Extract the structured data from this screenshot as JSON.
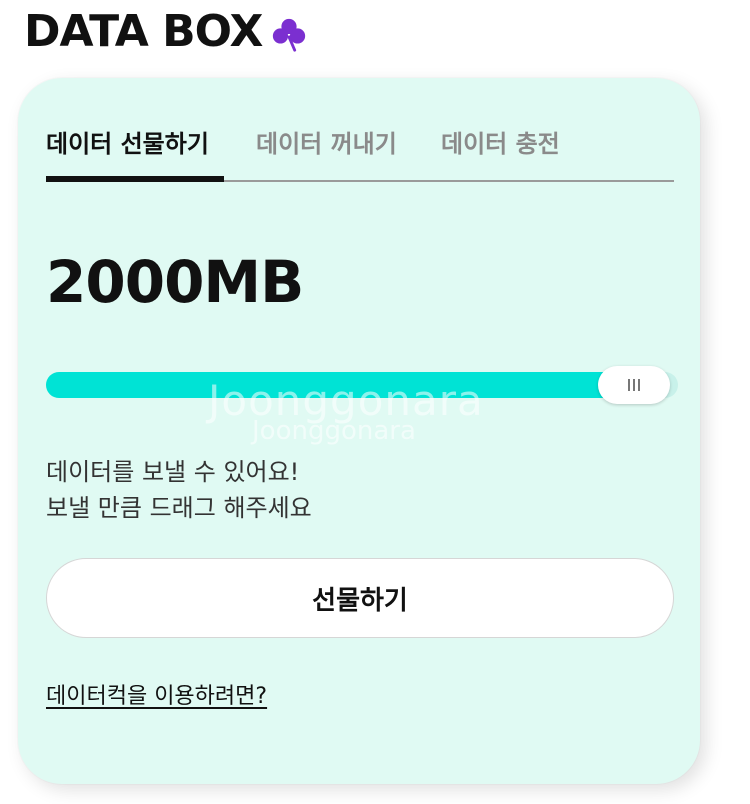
{
  "header": {
    "brand": "DATA BOX",
    "logo_icon": "clover-icon",
    "logo_color": "#7b2fd0"
  },
  "tabs": [
    {
      "label": "데이터 선물하기",
      "active": true
    },
    {
      "label": "데이터 꺼내기",
      "active": false
    },
    {
      "label": "데이터 충전",
      "active": false
    }
  ],
  "amount": "2000MB",
  "slider": {
    "fraction": 0.93,
    "fill_color": "#00e3d5"
  },
  "watermark": {
    "line1": "Joonggonara",
    "line2": "Joonggonara"
  },
  "help": {
    "line1": "데이터를 보낼 수 있어요!",
    "line2": "보낼 만큼 드래그 해주세요"
  },
  "gift_button": "선물하기",
  "info_link": "데이터컥을 이용하려면?",
  "colors": {
    "card_bg": "#e0faf3",
    "accent": "#00e3d5"
  }
}
